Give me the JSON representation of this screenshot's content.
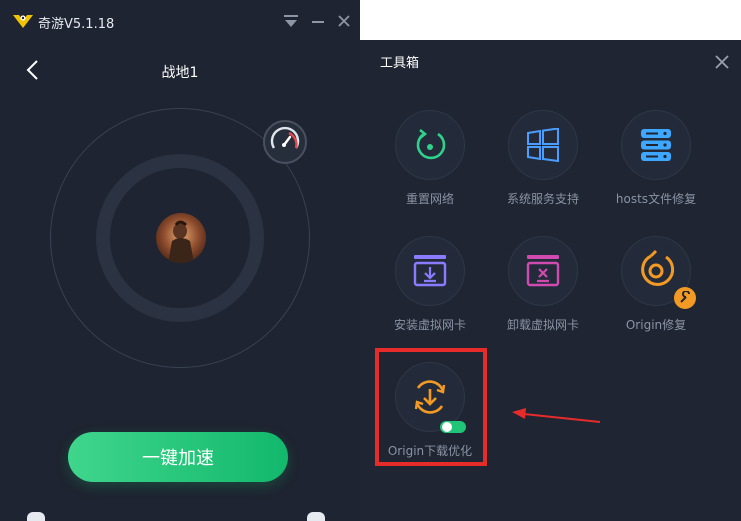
{
  "app": {
    "title": "奇游V5.1.18"
  },
  "main": {
    "game_title": "战地1",
    "accelerate_label": "一键加速"
  },
  "toolbox": {
    "title": "工具箱",
    "tools": [
      {
        "label": "重置网络",
        "icon": "reset-network-icon",
        "color": "#2fd28a"
      },
      {
        "label": "系统服务支持",
        "icon": "windows-icon",
        "color": "#4a9eff"
      },
      {
        "label": "hosts文件修复",
        "icon": "server-icon",
        "color": "#3ea7ff"
      },
      {
        "label": "安装虚拟网卡",
        "icon": "install-nic-icon",
        "color": "#8b7cff"
      },
      {
        "label": "卸载虚拟网卡",
        "icon": "uninstall-nic-icon",
        "color": "#d04ab0"
      },
      {
        "label": "Origin修复",
        "icon": "origin-repair-icon",
        "color": "#f29a24"
      },
      {
        "label": "Origin下载优化",
        "icon": "origin-download-icon",
        "color": "#f29a24"
      }
    ],
    "origin_download_toggle_on": true
  },
  "colors": {
    "accent_green": "#20c477",
    "highlight_red": "#e62b2b",
    "panel_bg": "#1f2532"
  }
}
